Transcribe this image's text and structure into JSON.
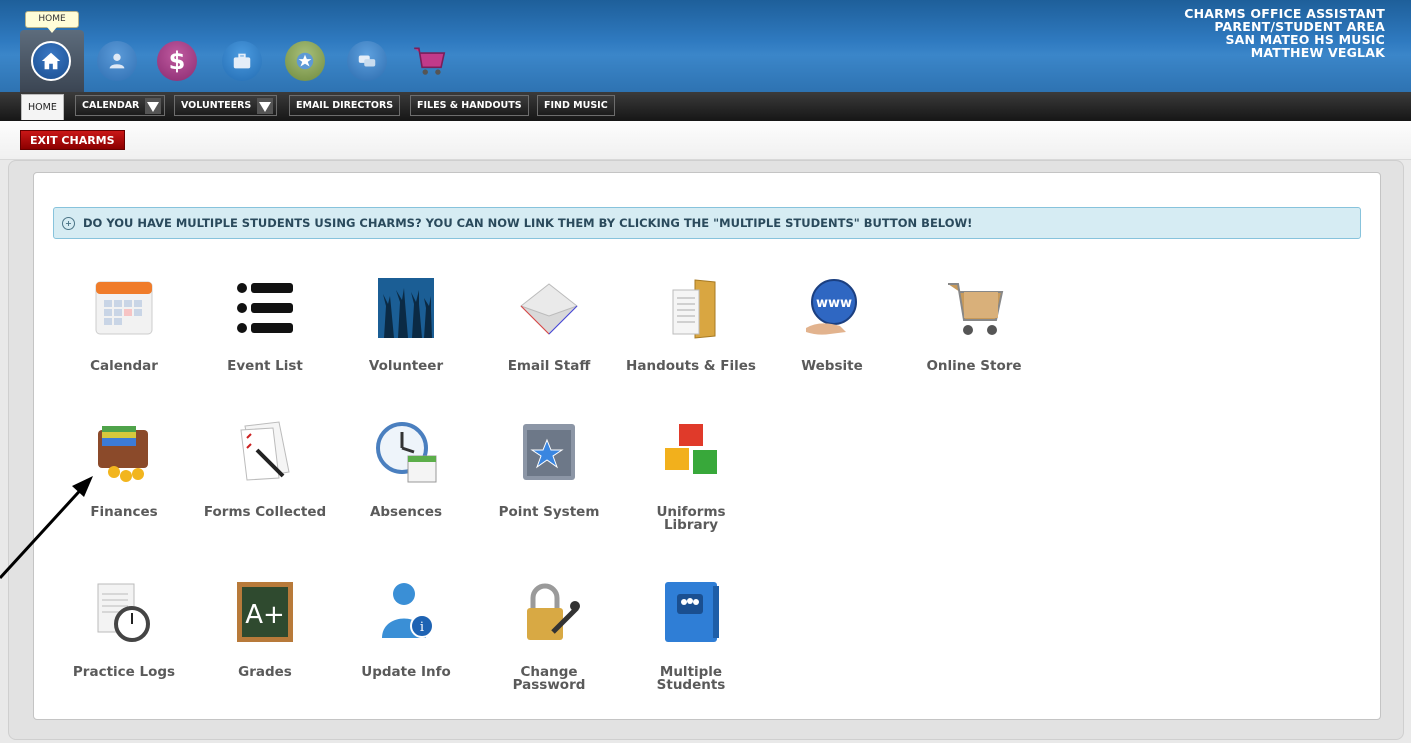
{
  "header": {
    "home_tooltip": "HOME",
    "brand_lines": [
      "CHARMS OFFICE ASSISTANT",
      "PARENT/STUDENT AREA",
      "SAN MATEO HS MUSIC",
      "MATTHEW VEGLAK"
    ],
    "top_icons": [
      "home-icon",
      "person-icon",
      "dollar-icon",
      "briefcase-icon",
      "star-icon",
      "chat-icon",
      "shopping-cart-icon"
    ]
  },
  "nav": {
    "home": "HOME",
    "calendar": "CALENDAR",
    "volunteers": "VOLUNTEERS",
    "email_directors": "EMAIL DIRECTORS",
    "files_handouts": "FILES & HANDOUTS",
    "find_music": "FIND MUSIC"
  },
  "exit_label": "EXIT CHARMS",
  "notice": "DO YOU HAVE MULTIPLE STUDENTS USING CHARMS? YOU CAN NOW LINK THEM BY CLICKING THE \"MULTIPLE STUDENTS\" BUTTON BELOW!",
  "tiles": [
    {
      "label": "Calendar",
      "icon": "calendar-icon"
    },
    {
      "label": "Event List",
      "icon": "list-icon"
    },
    {
      "label": "Volunteer",
      "icon": "volunteer-hands-icon"
    },
    {
      "label": "Email Staff",
      "icon": "envelope-icon"
    },
    {
      "label": "Handouts & Files",
      "icon": "folder-icon"
    },
    {
      "label": "Website",
      "icon": "globe-www-icon"
    },
    {
      "label": "Online Store",
      "icon": "shopping-cart-icon"
    },
    {
      "label": "Finances",
      "icon": "wallet-icon"
    },
    {
      "label": "Forms Collected",
      "icon": "forms-pen-icon"
    },
    {
      "label": "Absences",
      "icon": "clock-calendar-icon"
    },
    {
      "label": "Point System",
      "icon": "star-folder-icon"
    },
    {
      "label": "Uniforms Library",
      "icon": "boxes-icon"
    },
    {
      "label": "Practice Logs",
      "icon": "stopwatch-document-icon"
    },
    {
      "label": "Grades",
      "icon": "chalkboard-grade-icon"
    },
    {
      "label": "Update Info",
      "icon": "user-info-icon"
    },
    {
      "label": "Change Password",
      "icon": "padlock-key-icon"
    },
    {
      "label": "Multiple Students",
      "icon": "students-book-icon"
    }
  ],
  "grade_text": "A+",
  "www_text": "www",
  "colors": {
    "header": "#2f7ac0",
    "exit": "#b01010",
    "notice_bg": "#d6ecf3",
    "label": "#5a5a5a"
  }
}
